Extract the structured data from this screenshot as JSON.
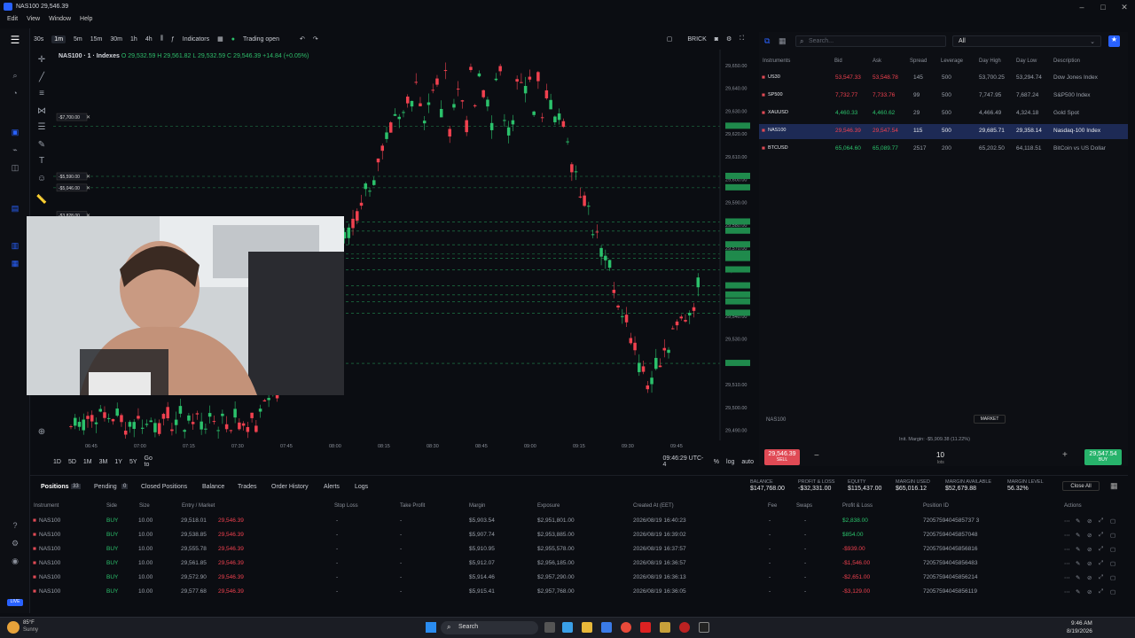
{
  "window": {
    "title": "NAS100 29,546.39",
    "menu": [
      "Edit",
      "View",
      "Window",
      "Help"
    ]
  },
  "toolbar": {
    "timeframes": [
      "30s",
      "1m",
      "5m",
      "15m",
      "30m",
      "1h",
      "4h"
    ],
    "active_tf": "1m",
    "indicators": "Indicators",
    "trading": "Trading open",
    "brick": "BRICK"
  },
  "chart": {
    "symbol": "NAS100 · 1 · Indexes",
    "ohlc": "O 29,532.59 H 29,561.82 L 29,532.59 C 29,546.39 +14.84 (+0.05%)",
    "price_labels": [
      "29,650.00",
      "29,640.00",
      "29,630.00",
      "29,620.00",
      "29,610.00",
      "29,600.00",
      "29,590.00",
      "29,580.00",
      "29,570.00",
      "29,560.00",
      "29,550.00",
      "29,540.00",
      "29,530.00",
      "29,520.00",
      "29,510.00",
      "29,500.00",
      "29,490.00"
    ],
    "time_labels": [
      "07:00",
      "07:15",
      "07:30",
      "07:45",
      "08:00",
      "08:15",
      "08:30",
      "08:45",
      "09:00",
      "09:15",
      "09:30",
      "09:45"
    ],
    "first_time": "06:45",
    "order_tags": [
      "-$7,700.00",
      "-$5,590.00",
      "-$5,046.00",
      "-$3,828.00"
    ],
    "ranges": [
      "1D",
      "5D",
      "1M",
      "3M",
      "1Y",
      "5Y",
      "Go to"
    ],
    "clock": "09:46:29 UTC-4",
    "log": "log",
    "auto": "auto"
  },
  "watchlist": {
    "search_placeholder": "Search...",
    "filter": "All",
    "headers": [
      "Instruments",
      "Bid",
      "Ask",
      "Spread",
      "Leverage",
      "Day High",
      "Day Low",
      "Description"
    ],
    "rows": [
      {
        "sym": "US30",
        "bid": "53,547.33",
        "ask": "53,548.78",
        "spread": "145",
        "lev": "500",
        "high": "53,700.25",
        "low": "53,294.74",
        "desc": "Dow Jones Index"
      },
      {
        "sym": "SP500",
        "bid": "7,732.77",
        "ask": "7,733.76",
        "spread": "99",
        "lev": "500",
        "high": "7,747.95",
        "low": "7,687.24",
        "desc": "S&P500 Index"
      },
      {
        "sym": "XAUUSD",
        "bid": "4,460.33",
        "ask": "4,460.62",
        "spread": "29",
        "lev": "500",
        "high": "4,466.49",
        "low": "4,324.18",
        "desc": "Gold Spot"
      },
      {
        "sym": "NAS100",
        "bid": "29,546.39",
        "ask": "29,547.54",
        "spread": "115",
        "lev": "500",
        "high": "29,685.71",
        "low": "29,358.14",
        "desc": "Nasdaq-100 Index"
      },
      {
        "sym": "BTCUSD",
        "bid": "65,064.60",
        "ask": "65,089.77",
        "spread": "2517",
        "lev": "200",
        "high": "65,202.50",
        "low": "64,118.51",
        "desc": "BitCoin vs US Dollar"
      }
    ]
  },
  "trade": {
    "symbol": "NAS100",
    "market": "MARKET",
    "margin": "Init. Margin: -$5,909.38 (11.22%)",
    "sell": "29,546.39",
    "sell_label": "SELL",
    "buy": "29,547.54",
    "buy_label": "BUY",
    "qty": "10",
    "qty_unit": "lots"
  },
  "bottom": {
    "tabs": [
      "Positions",
      "Pending",
      "Closed Positions",
      "Balance",
      "Trades",
      "Order History",
      "Alerts",
      "Logs"
    ],
    "positions_count": "33",
    "pending_count": "0",
    "account": [
      {
        "label": "BALANCE",
        "value": "$147,768.00"
      },
      {
        "label": "PROFIT & LOSS",
        "value": "-$32,331.00"
      },
      {
        "label": "EQUITY",
        "value": "$115,437.00"
      },
      {
        "label": "MARGIN USED",
        "value": "$65,016.12"
      },
      {
        "label": "MARGIN AVAILABLE",
        "value": "$52,679.88"
      },
      {
        "label": "MARGIN LEVEL",
        "value": "56.32%"
      }
    ],
    "close_all": "Close All",
    "headers": [
      "Instrument",
      "Side",
      "Size",
      "Entry / Market",
      "Stop Loss",
      "Take Profit",
      "Margin",
      "Exposure",
      "Created At (EET)",
      "Fee",
      "Swaps",
      "Profit & Loss",
      "Position ID",
      "Actions"
    ],
    "rows": [
      {
        "inst": "NAS100",
        "side": "BUY",
        "size": "10.00",
        "entry": "29,518.01",
        "market": "29,546.39",
        "sl": "-",
        "tp": "-",
        "margin": "$5,903.54",
        "exp": "$2,951,801.00",
        "created": "2026/08/19 16:40:23",
        "fee": "-",
        "swap": "-",
        "pl": "$2,838.00",
        "plc": "grn",
        "id": "7205759404585737 3"
      },
      {
        "inst": "NAS100",
        "side": "BUY",
        "size": "10.00",
        "entry": "29,538.85",
        "market": "29,546.39",
        "sl": "-",
        "tp": "-",
        "margin": "$5,907.74",
        "exp": "$2,953,885.00",
        "created": "2026/08/19 16:39:02",
        "fee": "-",
        "swap": "-",
        "pl": "$854.00",
        "plc": "grn",
        "id": "72057594045857048"
      },
      {
        "inst": "NAS100",
        "side": "BUY",
        "size": "10.00",
        "entry": "29,555.78",
        "market": "29,546.39",
        "sl": "-",
        "tp": "-",
        "margin": "$5,910.95",
        "exp": "$2,955,578.00",
        "created": "2026/08/19 16:37:57",
        "fee": "-",
        "swap": "-",
        "pl": "-$939.00",
        "plc": "red",
        "id": "72057594045856816"
      },
      {
        "inst": "NAS100",
        "side": "BUY",
        "size": "10.00",
        "entry": "29,561.85",
        "market": "29,546.39",
        "sl": "-",
        "tp": "-",
        "margin": "$5,912.07",
        "exp": "$2,956,185.00",
        "created": "2026/08/19 16:36:57",
        "fee": "-",
        "swap": "-",
        "pl": "-$1,546.00",
        "plc": "red",
        "id": "72057594045856483"
      },
      {
        "inst": "NAS100",
        "side": "BUY",
        "size": "10.00",
        "entry": "29,572.90",
        "market": "29,546.39",
        "sl": "-",
        "tp": "-",
        "margin": "$5,914.46",
        "exp": "$2,957,290.00",
        "created": "2026/08/19 16:36:13",
        "fee": "-",
        "swap": "-",
        "pl": "-$2,651.00",
        "plc": "red",
        "id": "72057594045856214"
      },
      {
        "inst": "NAS100",
        "side": "BUY",
        "size": "10.00",
        "entry": "29,577.68",
        "market": "29,546.39",
        "sl": "-",
        "tp": "-",
        "margin": "$5,915.41",
        "exp": "$2,957,768.00",
        "created": "2026/08/19 16:36:05",
        "fee": "-",
        "swap": "-",
        "pl": "-$3,129.00",
        "plc": "red",
        "id": "72057594045856119"
      }
    ]
  },
  "taskbar": {
    "weather_temp": "85°F",
    "weather": "Sunny",
    "search": "Search",
    "time": "9:46 AM",
    "date": "8/19/2026"
  },
  "colors": {
    "up": "#2bc16b",
    "down": "#f0414f",
    "accent": "#2962ff"
  }
}
